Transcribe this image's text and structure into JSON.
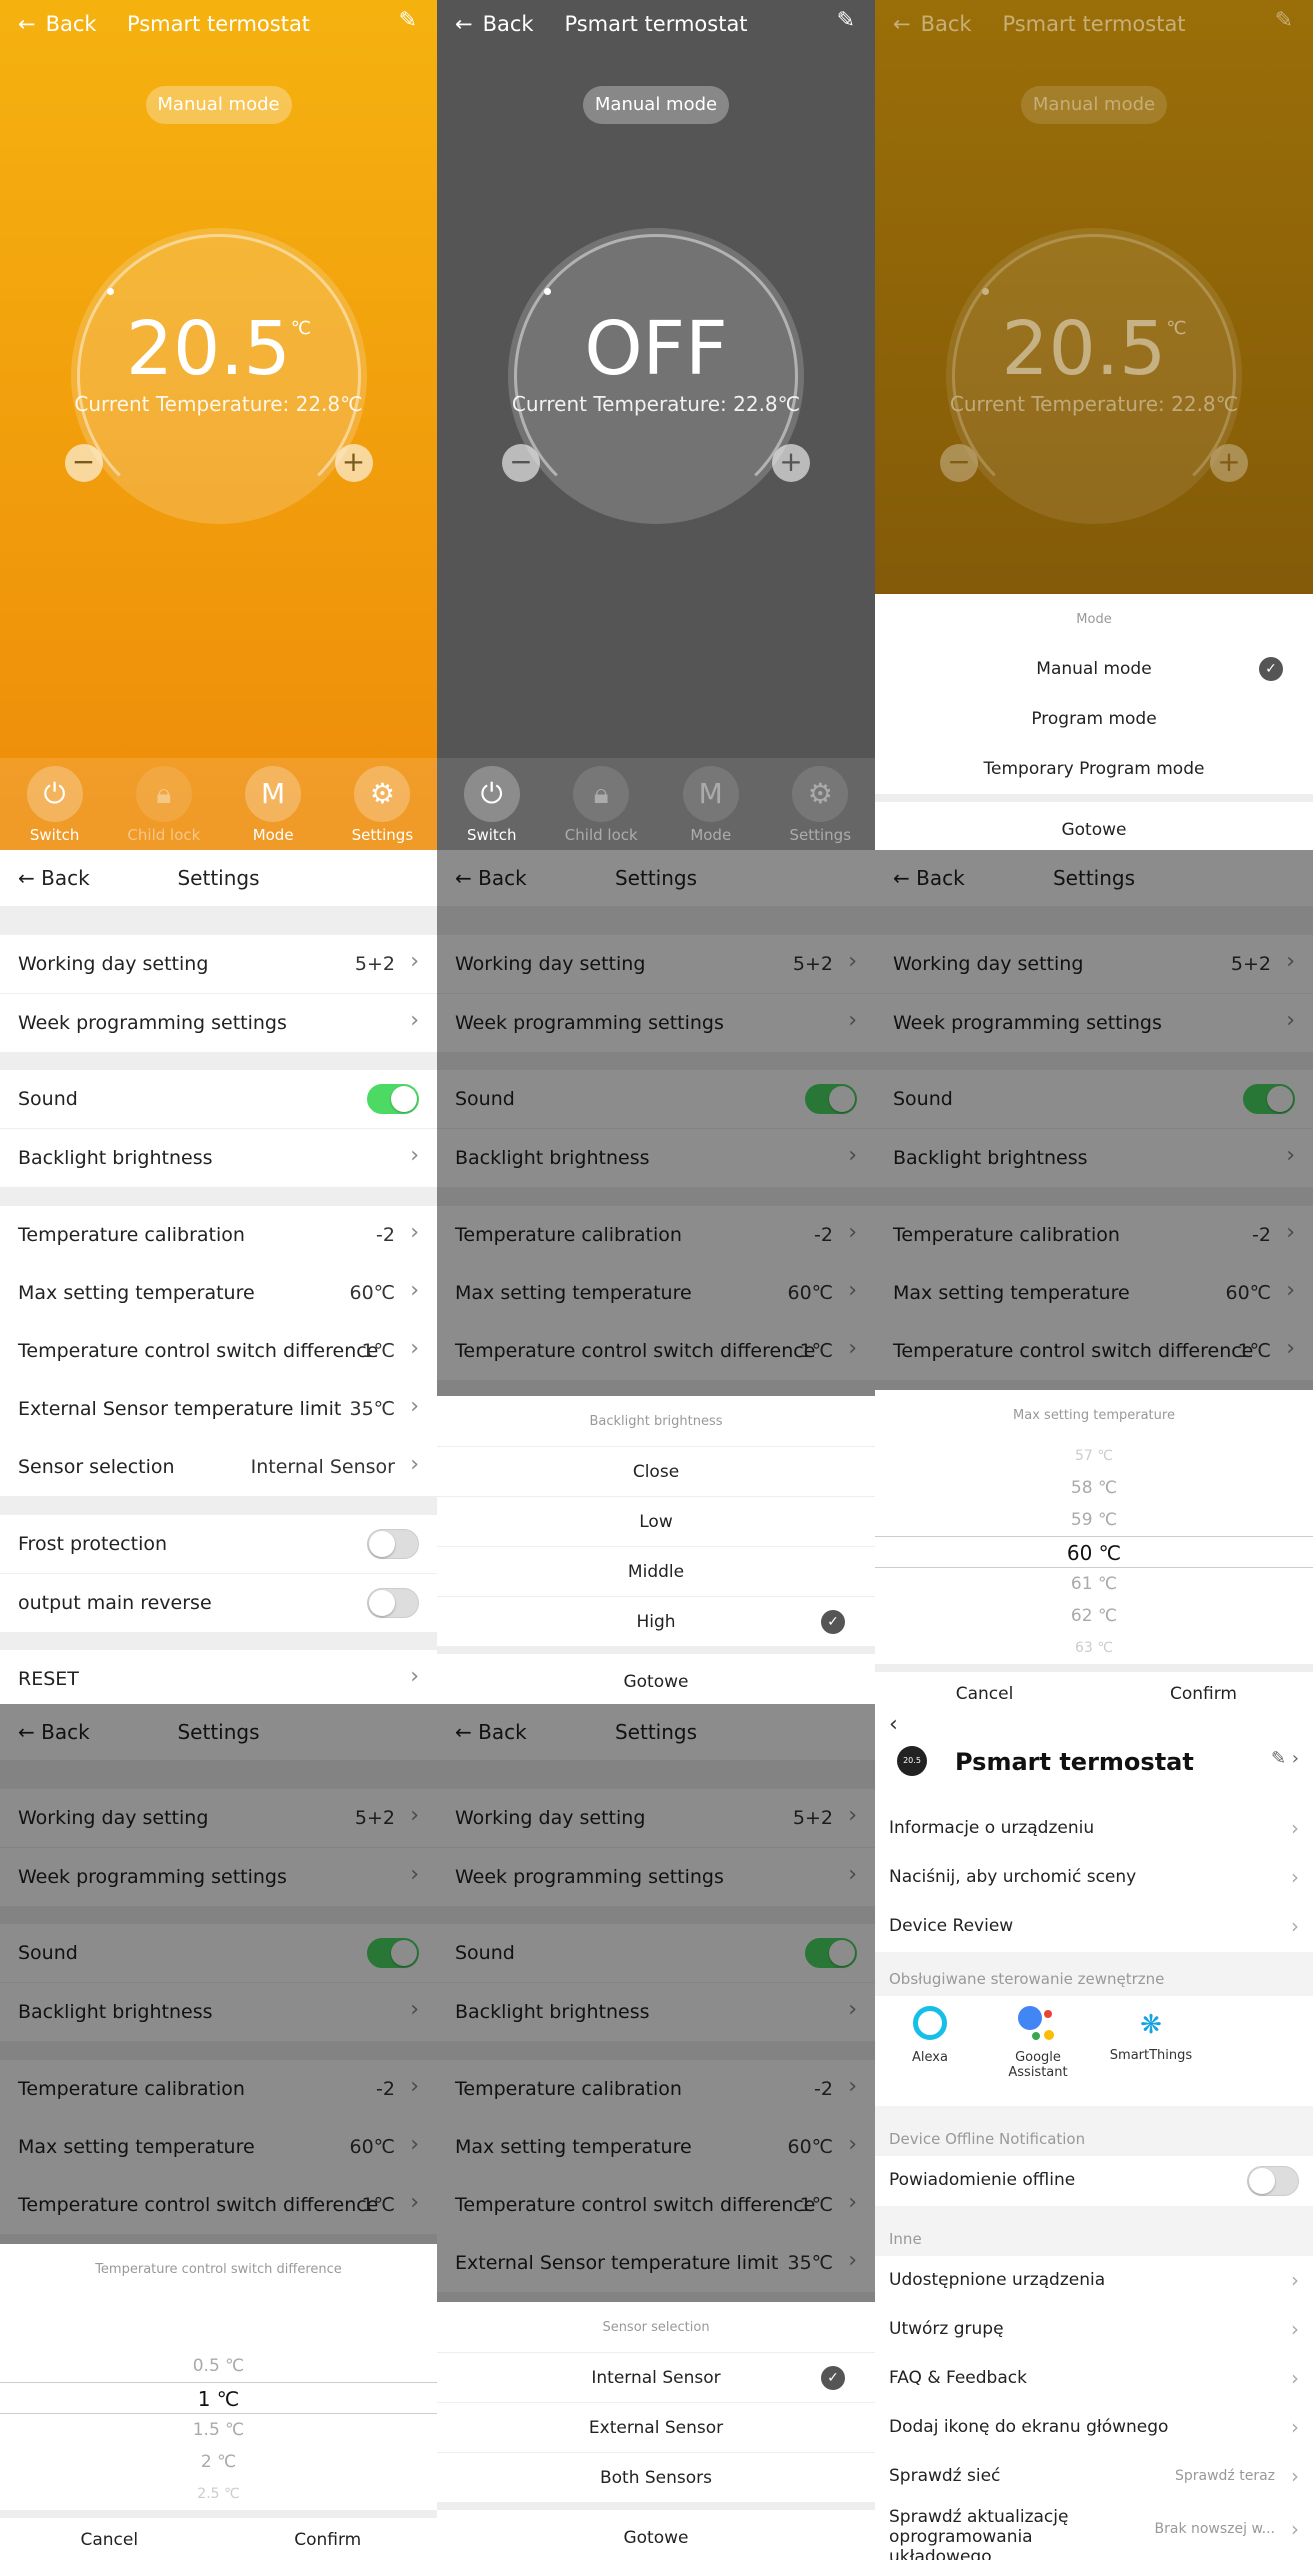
{
  "colors": {
    "orange": "#f39c12",
    "dark_gray": "#555555",
    "green": "#4cd964"
  },
  "thermo": {
    "back": "Back",
    "title": "Psmart termostat",
    "mode": "Manual mode",
    "temp": "20.5",
    "unit": "℃",
    "off": "OFF",
    "current": "Current Temperature: 22.8℃",
    "tabs": [
      {
        "label": "Switch",
        "icon": "power-icon"
      },
      {
        "label": "Child lock",
        "icon": "lock-icon"
      },
      {
        "label": "Mode",
        "icon": "mode-m-icon"
      },
      {
        "label": "Settings",
        "icon": "gear-icon"
      }
    ]
  },
  "mode_sheet": {
    "title": "Mode",
    "options": [
      "Manual mode",
      "Program mode",
      "Temporary Program mode"
    ],
    "selected": "Manual mode",
    "done": "Gotowe"
  },
  "settings": {
    "back": "Back",
    "title": "Settings",
    "working_day": {
      "label": "Working day setting",
      "value": "5+2"
    },
    "week_prog": {
      "label": "Week programming settings"
    },
    "sound": {
      "label": "Sound",
      "on": true
    },
    "backlight": {
      "label": "Backlight brightness"
    },
    "temp_cal": {
      "label": "Temperature calibration",
      "value": "-2"
    },
    "max_temp": {
      "label": "Max setting temperature",
      "value": "60℃"
    },
    "switch_diff": {
      "label": "Temperature control switch difference",
      "value": "1℃"
    },
    "ext_limit": {
      "label": "External Sensor temperature limit",
      "value": "35℃"
    },
    "sensor": {
      "label": "Sensor selection",
      "value": "Internal Sensor"
    },
    "frost": {
      "label": "Frost protection",
      "on": false
    },
    "output_rev": {
      "label": "output main reverse",
      "on": false
    },
    "reset": {
      "label": "RESET"
    }
  },
  "backlight_sheet": {
    "title": "Backlight brightness",
    "options": [
      "Close",
      "Low",
      "Middle",
      "High"
    ],
    "selected": "High",
    "done": "Gotowe"
  },
  "max_picker": {
    "title": "Max setting temperature",
    "items": [
      "57 ℃",
      "58 ℃",
      "59 ℃",
      "60 ℃",
      "61 ℃",
      "62 ℃",
      "63 ℃"
    ],
    "selected": "60 ℃",
    "cancel": "Cancel",
    "confirm": "Confirm"
  },
  "diff_picker": {
    "title": "Temperature control switch difference",
    "items": [
      "0.5 ℃",
      "1 ℃",
      "1.5 ℃",
      "2 ℃",
      "2.5 ℃"
    ],
    "selected": "1 ℃",
    "cancel": "Cancel",
    "confirm": "Confirm"
  },
  "sensor_sheet": {
    "title": "Sensor selection",
    "options": [
      "Internal Sensor",
      "External Sensor",
      "Both Sensors"
    ],
    "selected": "Internal Sensor",
    "done": "Gotowe"
  },
  "device": {
    "name": "Psmart termostat",
    "avatar_text": "20.5",
    "rows1": [
      "Informacje o urządzeniu",
      "Naciśnij, aby urchomić sceny",
      "Device Review"
    ],
    "ext_section": "Obsługiwane sterowanie zewnętrzne",
    "brands": [
      {
        "name": "Alexa",
        "icon": "alexa-icon"
      },
      {
        "name": "Google Assistant",
        "icon": "google-assistant-icon"
      },
      {
        "name": "SmartThings",
        "icon": "smartthings-icon"
      }
    ],
    "offline_section": "Device Offline Notification",
    "offline_label": "Powiadomienie offline",
    "other_section": "Inne",
    "rows2": [
      "Udostępnione urządzenia",
      "Utwórz grupę",
      "FAQ & Feedback",
      "Dodaj ikonę do ekranu głównego"
    ],
    "network": {
      "label": "Sprawdź sieć",
      "value": "Sprawdź teraz"
    },
    "firmware": {
      "label": "Sprawdź aktualizację oprogramowania układowego",
      "value": "Brak nowszej w..."
    }
  }
}
